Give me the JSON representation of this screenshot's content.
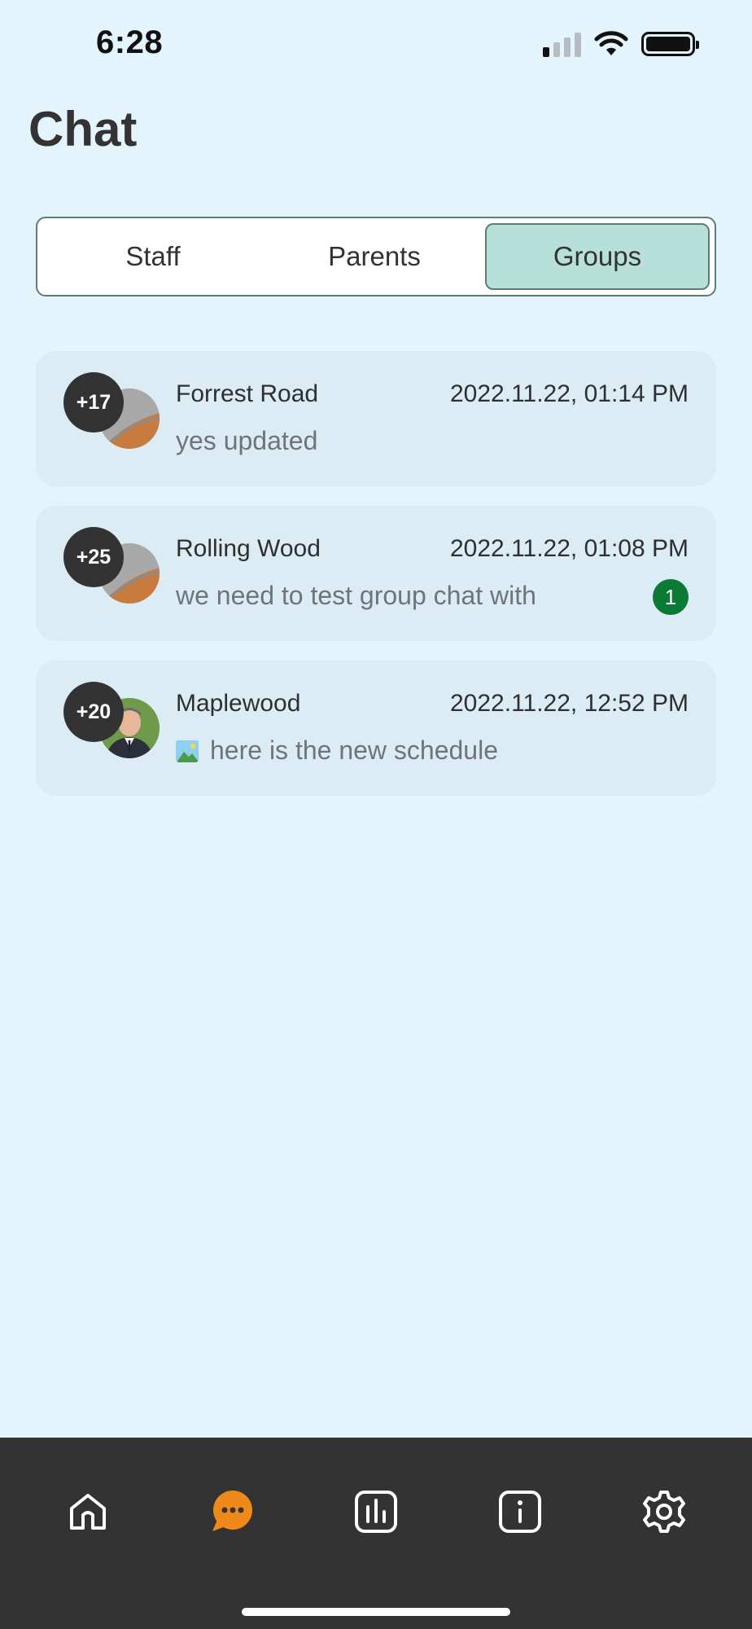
{
  "status_bar": {
    "time": "6:28"
  },
  "header": {
    "title": "Chat"
  },
  "tabs": [
    {
      "label": "Staff",
      "active": false
    },
    {
      "label": "Parents",
      "active": false
    },
    {
      "label": "Groups",
      "active": true
    }
  ],
  "chats": [
    {
      "name": "Forrest Road",
      "time": "2022.11.22, 01:14 PM",
      "preview": "yes updated",
      "member_count": "+17",
      "unread": null,
      "avatar": "grey-placeholder-avatar"
    },
    {
      "name": "Rolling Wood",
      "time": "2022.11.22, 01:08 PM",
      "preview": "we need to test group chat with",
      "member_count": "+25",
      "unread": "1",
      "avatar": "grey-placeholder-avatar"
    },
    {
      "name": "Maplewood",
      "time": "2022.11.22, 12:52 PM",
      "preview": "here is the new schedule",
      "member_count": "+20",
      "unread": null,
      "avatar": "person-photo-avatar",
      "preview_icon": "image-icon"
    }
  ],
  "nav": {
    "items": [
      {
        "icon": "home-icon",
        "active": false
      },
      {
        "icon": "chat-icon",
        "active": true
      },
      {
        "icon": "chart-icon",
        "active": false
      },
      {
        "icon": "info-icon",
        "active": false
      },
      {
        "icon": "gear-icon",
        "active": false
      }
    ]
  },
  "colors": {
    "background": "#e4f4fc",
    "card": "#dcecf5",
    "tab_active": "#b7e0d8",
    "tab_border": "#5f7d76",
    "unread_badge": "#0b7a34",
    "nav_background": "#333333",
    "nav_active": "#f0891c"
  }
}
